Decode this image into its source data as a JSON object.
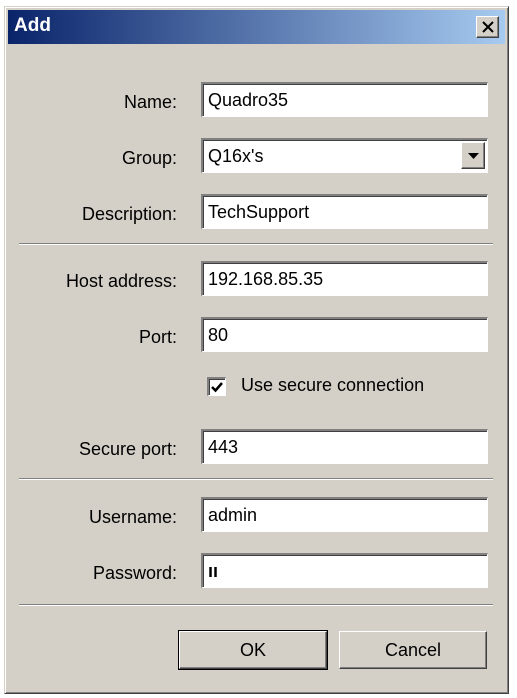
{
  "window": {
    "title": "Add"
  },
  "form": {
    "name": {
      "label": "Name:",
      "value": "Quadro35"
    },
    "group": {
      "label": "Group:",
      "value": "Q16x's"
    },
    "description": {
      "label": "Description:",
      "value": "TechSupport"
    },
    "host": {
      "label": "Host address:",
      "value": "192.168.85.35"
    },
    "port": {
      "label": "Port:",
      "value": "80"
    },
    "secure": {
      "label": "Use secure connection",
      "checked": true
    },
    "secure_port": {
      "label": "Secure port:",
      "value": "443"
    },
    "username": {
      "label": "Username:",
      "value": "admin"
    },
    "password": {
      "label": "Password:",
      "value": "ıı"
    }
  },
  "buttons": {
    "ok": "OK",
    "cancel": "Cancel"
  },
  "icons": {
    "close": "close-icon",
    "dropdown": "chevron-down-icon",
    "check": "check-icon"
  },
  "colors": {
    "title_start": "#0a246a",
    "title_end": "#a6caf0",
    "face": "#d4d0c8"
  }
}
